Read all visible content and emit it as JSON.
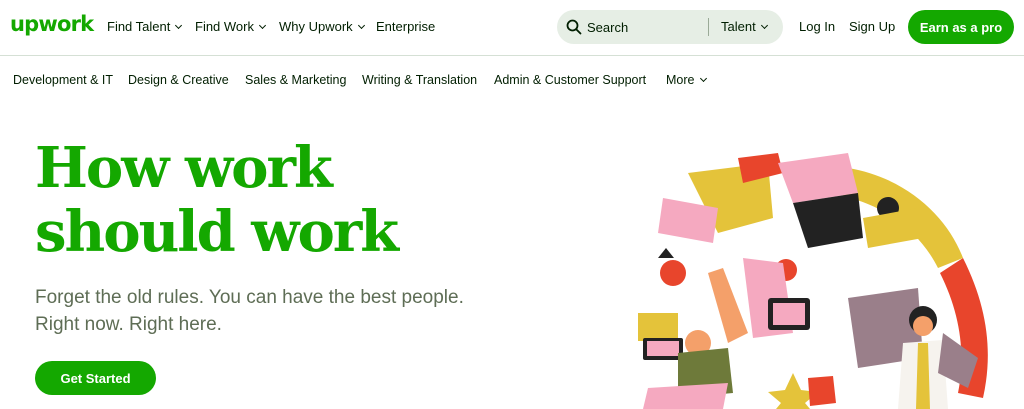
{
  "brand": {
    "logo_text": "upwork",
    "color": "#14a800"
  },
  "nav": {
    "items": [
      {
        "label": "Find Talent",
        "dropdown": true
      },
      {
        "label": "Find Work",
        "dropdown": true
      },
      {
        "label": "Why Upwork",
        "dropdown": true
      },
      {
        "label": "Enterprise",
        "dropdown": false
      }
    ],
    "search": {
      "placeholder": "Search",
      "scope": "Talent"
    },
    "login_label": "Log In",
    "signup_label": "Sign Up",
    "cta_label": "Earn as a pro"
  },
  "categories": [
    "Development & IT",
    "Design & Creative",
    "Sales & Marketing",
    "Writing & Translation",
    "Admin & Customer Support"
  ],
  "categories_more": "More",
  "hero": {
    "title_line1": "How work",
    "title_line2": "should work",
    "subtitle_line1": "Forget the old rules. You can have the best people.",
    "subtitle_line2": "Right now. Right here.",
    "cta_label": "Get Started"
  },
  "colors": {
    "accent": "#14a800",
    "search_bg": "#e6eee5",
    "subtitle": "#5e6d55",
    "illustration_yellow": "#e4c33a",
    "illustration_red": "#e8452c",
    "illustration_pink": "#f5a9c0",
    "illustration_mauve": "#9a7f8a"
  },
  "icons": {
    "search": "search-icon",
    "chevron": "chevron-down-icon"
  }
}
